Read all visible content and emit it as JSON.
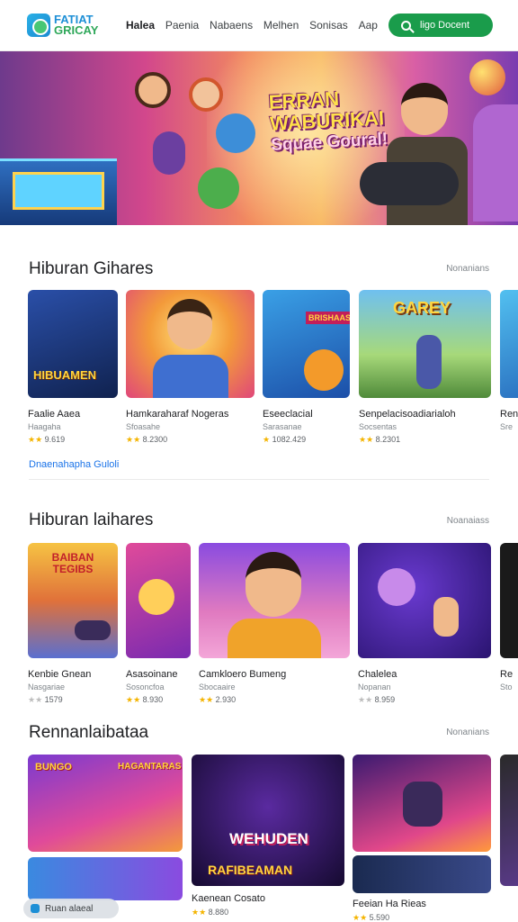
{
  "header": {
    "logo_line1": "FATIAT",
    "logo_line2": "GRICAY",
    "nav": [
      "Halea",
      "Paenia",
      "Nabaens",
      "Melhen",
      "Sonisas",
      "Aap"
    ],
    "search_label": "ligo Docent"
  },
  "hero": {
    "title_lines": [
      "ERRAN",
      "WABURIKAI",
      "Squae Goural!"
    ]
  },
  "sections": [
    {
      "title": "Hiburan Gihares",
      "see_more": "Nonanians",
      "cards": [
        {
          "name": "Faalie Aaea",
          "sub": "Haagaha",
          "rating": "9.619",
          "stars": 2,
          "label": "HIBUAMEN"
        },
        {
          "name": "Hamkaraharaf Nogeras",
          "sub": "Sfoasahe",
          "rating": "8.2300",
          "stars": 2,
          "label": ""
        },
        {
          "name": "Eseeclacial",
          "sub": "Sarasanae",
          "rating": "1082.429",
          "stars": 1,
          "label": "BRISHAAS"
        },
        {
          "name": "Senpelacisoadiarialoh",
          "sub": "Socsentas",
          "rating": "8.2301",
          "stars": 2,
          "label": "GAREY"
        },
        {
          "name": "Ren",
          "sub": "Sre",
          "rating": "",
          "stars": 0,
          "label": ""
        }
      ],
      "link": "Dnaenahapha Guloli"
    },
    {
      "title": "Hiburan laihares",
      "see_more": "Noanaiass",
      "cards": [
        {
          "name": "Kenbie Gnean",
          "sub": "Nasgariae",
          "rating": "1579",
          "stars": 0,
          "label": "BAIBAN TEGIBS"
        },
        {
          "name": "Asasoinane",
          "sub": "Sosoncfoa",
          "rating": "8.930",
          "stars": 2,
          "label": ""
        },
        {
          "name": "Camkloero Bumeng",
          "sub": "Sbocaaire",
          "rating": "2.930",
          "stars": 2,
          "label": ""
        },
        {
          "name": "Chalelea",
          "sub": "Nopanan",
          "rating": "8.959",
          "stars": 0,
          "label": ""
        },
        {
          "name": "Re",
          "sub": "Sto",
          "rating": "",
          "stars": 0,
          "label": ""
        }
      ]
    },
    {
      "title": "Rennanlaibataa",
      "see_more": "Nonanians",
      "cards": [
        {
          "name": "Kaenean Cosato",
          "sub": "",
          "rating": "8.880",
          "stars": 2,
          "label": "WEHUDEN"
        },
        {
          "name": "Feeian Ha Rieas",
          "sub": "",
          "rating": "5.590",
          "stars": 2,
          "label": ""
        }
      ],
      "card_labels": [
        "BUNGO",
        "HAGANTARAS",
        "RAFIBEAMAN"
      ]
    }
  ],
  "bottom_bar": "Ruan alaeal",
  "colors": {
    "accent_green": "#1a9c4b",
    "link_blue": "#1a73e8",
    "star": "#f4b400"
  }
}
